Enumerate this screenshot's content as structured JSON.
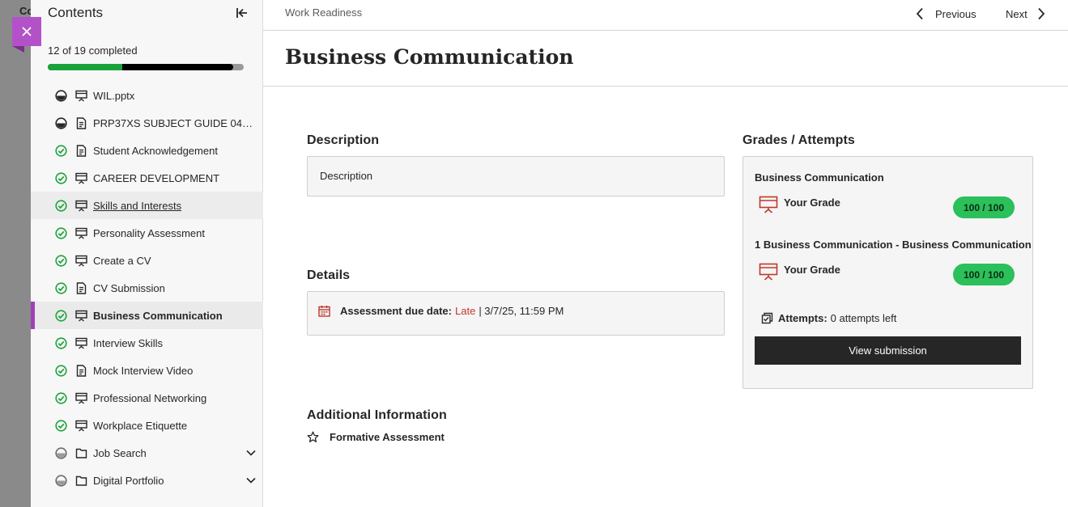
{
  "backdrop": {
    "text": "Co"
  },
  "sidebar": {
    "title": "Contents",
    "progress_text": "12 of 19 completed",
    "progress": {
      "completed": 12,
      "total": 19
    },
    "items": [
      {
        "label": "WIL.pptx",
        "status": "partial",
        "type": "presentation"
      },
      {
        "label": "PRP37XS SUBJECT GUIDE 04-04-...",
        "status": "partial",
        "type": "document"
      },
      {
        "label": "Student Acknowledgement",
        "status": "complete",
        "type": "document"
      },
      {
        "label": "CAREER DEVELOPMENT",
        "status": "complete",
        "type": "presentation"
      },
      {
        "label": "Skills and Interests",
        "status": "complete",
        "type": "presentation"
      },
      {
        "label": "Personality Assessment",
        "status": "complete",
        "type": "presentation"
      },
      {
        "label": "Create a CV",
        "status": "complete",
        "type": "presentation"
      },
      {
        "label": "CV Submission",
        "status": "complete",
        "type": "document"
      },
      {
        "label": "Business Communication",
        "status": "complete",
        "type": "presentation"
      },
      {
        "label": "Interview Skills",
        "status": "complete",
        "type": "presentation"
      },
      {
        "label": "Mock Interview Video",
        "status": "complete",
        "type": "document"
      },
      {
        "label": "Professional Networking",
        "status": "complete",
        "type": "presentation"
      },
      {
        "label": "Workplace Etiquette",
        "status": "complete",
        "type": "presentation"
      },
      {
        "label": "Job Search",
        "status": "not-started",
        "type": "folder"
      },
      {
        "label": "Digital Portfolio",
        "status": "not-started",
        "type": "folder"
      }
    ]
  },
  "topbar": {
    "breadcrumb": "Work Readiness",
    "previous_label": "Previous",
    "next_label": "Next"
  },
  "page": {
    "title": "Business Communication",
    "description": {
      "heading": "Description",
      "text": "Description"
    },
    "details": {
      "heading": "Details",
      "due_label": "Assessment due date:",
      "status": "Late",
      "due_date": "| 3/7/25, 11:59 PM"
    },
    "additional": {
      "heading": "Additional Information",
      "item": "Formative Assessment"
    },
    "grades": {
      "heading": "Grades / Attempts",
      "sections": [
        {
          "title": "Business Communication",
          "grade_label": "Your Grade",
          "score": "100 / 100"
        },
        {
          "title": "1 Business Communication - Business Communication",
          "grade_label": "Your Grade",
          "score": "100 / 100"
        }
      ],
      "attempts_label": "Attempts:",
      "attempts_value": "0 attempts left",
      "view_button": "View submission"
    }
  },
  "colors": {
    "accent": "#b352c8",
    "active_bar": "#a040b8",
    "complete": "#1aa33a",
    "pill": "#2bc05a",
    "late": "#c0392b",
    "grade_icon": "#c0392b"
  }
}
